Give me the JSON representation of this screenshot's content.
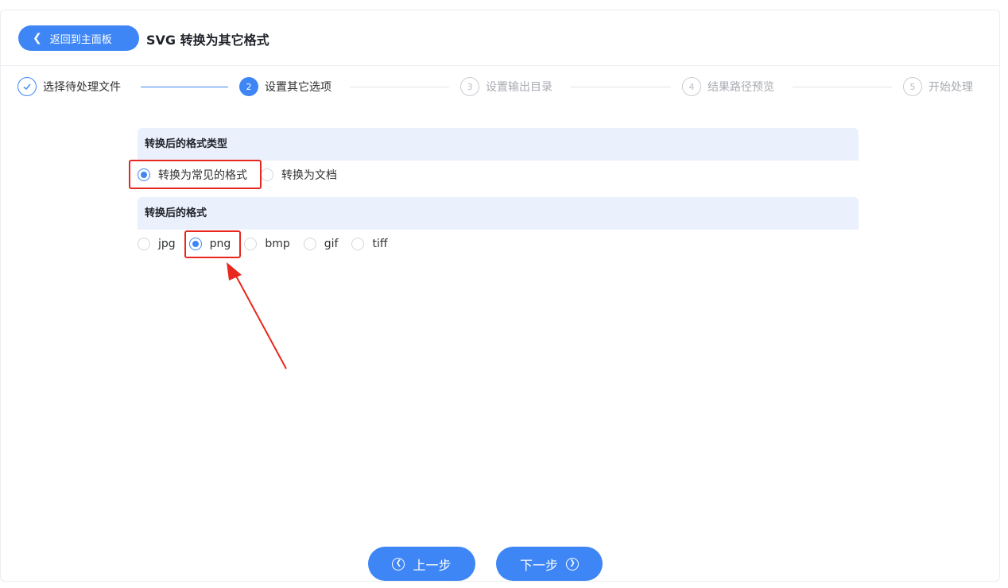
{
  "header": {
    "back_label": "返回到主面板",
    "title": "SVG 转换为其它格式"
  },
  "steps": [
    {
      "num": "✓",
      "label": "选择待处理文件",
      "state": "done"
    },
    {
      "num": "2",
      "label": "设置其它选项",
      "state": "active"
    },
    {
      "num": "3",
      "label": "设置输出目录",
      "state": "todo"
    },
    {
      "num": "4",
      "label": "结果路径预览",
      "state": "todo"
    },
    {
      "num": "5",
      "label": "开始处理",
      "state": "todo"
    }
  ],
  "format_type": {
    "heading": "转换后的格式类型",
    "options": [
      {
        "label": "转换为常见的格式",
        "selected": true
      },
      {
        "label": "转换为文档",
        "selected": false
      }
    ]
  },
  "format": {
    "heading": "转换后的格式",
    "options": [
      {
        "label": "jpg",
        "selected": false
      },
      {
        "label": "png",
        "selected": true
      },
      {
        "label": "bmp",
        "selected": false
      },
      {
        "label": "gif",
        "selected": false
      },
      {
        "label": "tiff",
        "selected": false
      }
    ]
  },
  "nav": {
    "prev_label": "上一步",
    "next_label": "下一步"
  },
  "colors": {
    "accent": "#3e86f5",
    "highlight": "#e8271f",
    "section_bg": "#eaf1fd"
  },
  "icons": {
    "back": "chevron-left-icon",
    "prev": "chevron-left-circle-icon",
    "next": "chevron-right-circle-icon",
    "done_step": "check-icon"
  }
}
